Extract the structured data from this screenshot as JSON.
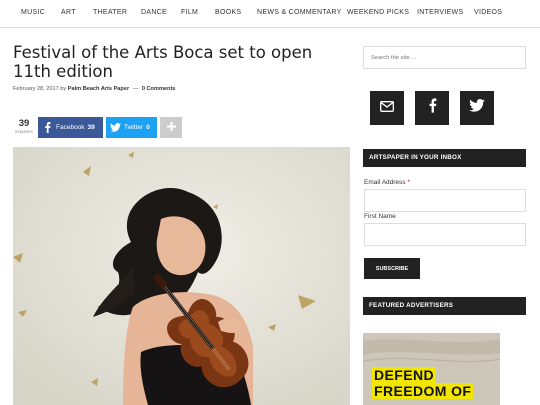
{
  "nav": {
    "items": [
      "MUSIC",
      "ART",
      "THEATER",
      "DANCE",
      "FILM",
      "BOOKS",
      "NEWS & COMMENTARY",
      "WEEKEND PICKS",
      "INTERVIEWS",
      "VIDEOS"
    ]
  },
  "article": {
    "title": "Festival of the Arts Boca set to open 11th edition",
    "date": "February 28, 2017",
    "by": "by",
    "author": "Palm Beach Arts Paper",
    "separator": "—",
    "comments": "0 Comments"
  },
  "share": {
    "count": "39",
    "count_label": "SHARES",
    "facebook": {
      "label": "Facebook",
      "count": "39",
      "color": "#3b5998",
      "icon": "facebook-icon"
    },
    "twitter": {
      "label": "Twitter",
      "count": "0",
      "color": "#1da1f2",
      "icon": "twitter-icon"
    },
    "more": {
      "icon": "plus-icon",
      "color": "#cccccc"
    }
  },
  "sidebar": {
    "search_placeholder": "Search the site ...",
    "social": [
      {
        "icon": "envelope-icon"
      },
      {
        "icon": "facebook-icon"
      },
      {
        "icon": "twitter-icon"
      }
    ],
    "newsletter": {
      "title": "ARTSPAPER IN YOUR INBOX",
      "email_label": "Email Address",
      "required_mark": "*",
      "first_name_label": "First Name",
      "subscribe_label": "SUBSCRIBE"
    },
    "advertisers": {
      "title": "FEATURED ADVERTISERS",
      "ad_lines": [
        "DEFEND",
        "FREEDOM OF"
      ],
      "highlight_color": "#f2e600"
    }
  }
}
